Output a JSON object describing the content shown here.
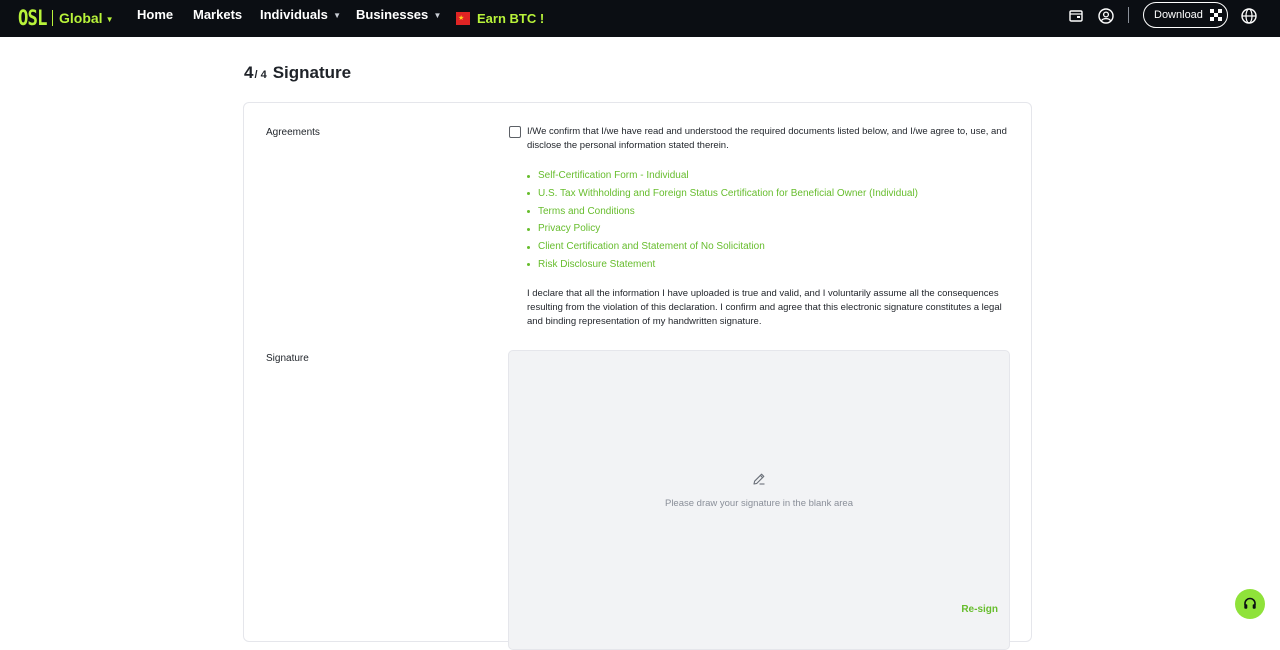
{
  "nav": {
    "logo_text": "OSL",
    "region": "Global",
    "items": [
      {
        "label": "Home"
      },
      {
        "label": "Markets"
      },
      {
        "label": "Individuals"
      },
      {
        "label": "Businesses"
      }
    ],
    "earn_label": "Earn BTC !",
    "download_label": "Download",
    "icons": [
      "wallet-icon",
      "account-icon",
      "qr-code-icon",
      "globe-icon"
    ],
    "colors": {
      "background": "#0b0e13",
      "accent": "#b8f33a"
    }
  },
  "step": {
    "current": "4",
    "total": "/ 4",
    "title": "Signature"
  },
  "agreements": {
    "label": "Agreements",
    "confirm_text": "I/We confirm that I/we have read and understood the required documents listed below, and I/we agree to, use, and disclose the personal information stated therein.",
    "checked": false,
    "documents": [
      "Self-Certification Form - Individual",
      "U.S. Tax Withholding and Foreign Status Certification for Beneficial Owner (Individual)",
      "Terms and Conditions",
      "Privacy Policy",
      "Client Certification and Statement of No Solicitation",
      "Risk Disclosure Statement"
    ],
    "declaration": "I declare that all the information I have uploaded is true and valid, and I voluntarily assume all the consequences resulting from the violation of this declaration. I confirm and agree that this electronic signature constitutes a legal and binding representation of my handwritten signature.",
    "link_color": "#67bd2d"
  },
  "signature": {
    "label": "Signature",
    "placeholder": "Please draw your signature in the blank area",
    "resign_label": "Re-sign",
    "icon": "pen-icon"
  },
  "support": {
    "icon": "headset-icon"
  }
}
